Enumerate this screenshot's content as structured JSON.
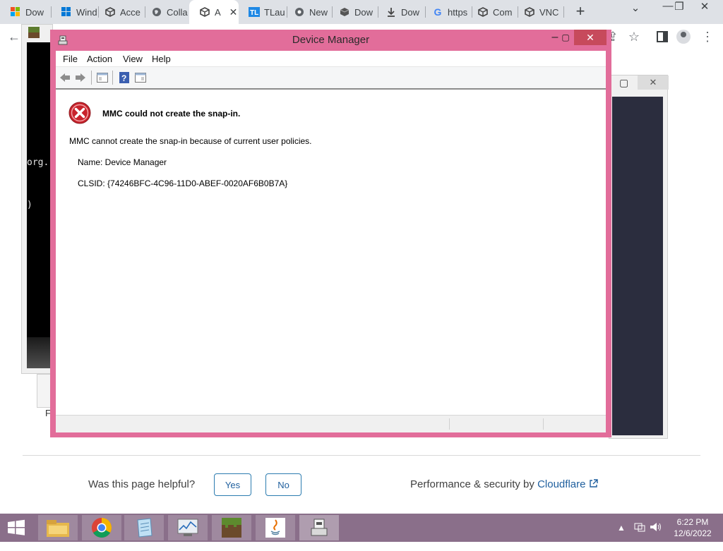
{
  "browser": {
    "tabs": [
      {
        "label": "Dow",
        "icon": "windows-logo-icon"
      },
      {
        "label": "Wind",
        "icon": "windows-logo-icon"
      },
      {
        "label": "Acce",
        "icon": "cube-icon"
      },
      {
        "label": "Colla",
        "icon": "globe-icon"
      },
      {
        "label": "A",
        "icon": "cube-icon",
        "active": true
      },
      {
        "label": "TLau",
        "icon": "tl-icon"
      },
      {
        "label": "New",
        "icon": "chrome-icon"
      },
      {
        "label": "Dow",
        "icon": "box-icon"
      },
      {
        "label": "Dow",
        "icon": "download-icon"
      },
      {
        "label": "https",
        "icon": "google-icon"
      },
      {
        "label": "Com",
        "icon": "cube-icon"
      },
      {
        "label": "VNC",
        "icon": "cube-icon"
      }
    ],
    "new_tab_symbol": "+",
    "tab_close_symbol": "✕"
  },
  "device_manager": {
    "title": "Device Manager",
    "menu": [
      "File",
      "Action",
      "View",
      "Help"
    ],
    "error_title": "MMC could not create the snap-in.",
    "error_description": "MMC cannot create the snap-in because of current user policies.",
    "name_line": "Name: Device Manager",
    "clsid_line": "CLSID: {74246BFC-4C96-11D0-ABEF-0020AF6B0B7A}"
  },
  "console_fragments": [
    "org.",
    ")"
  ],
  "left_fragment": "F",
  "page_footer": {
    "helpful_question": "Was this page helpful?",
    "yes_label": "Yes",
    "no_label": "No",
    "performance_text": "Performance & security by",
    "cloudflare_link": "Cloudflare"
  },
  "taskbar": {
    "apps": [
      "file-explorer",
      "chrome",
      "notepad",
      "performance-monitor",
      "minecraft",
      "java",
      "device-manager"
    ],
    "time": "6:22 PM",
    "date": "12/6/2022"
  },
  "colors": {
    "accent_window_border": "#e26d9a",
    "taskbar": "#8a6f8a",
    "link_blue": "#1f5f9e"
  }
}
